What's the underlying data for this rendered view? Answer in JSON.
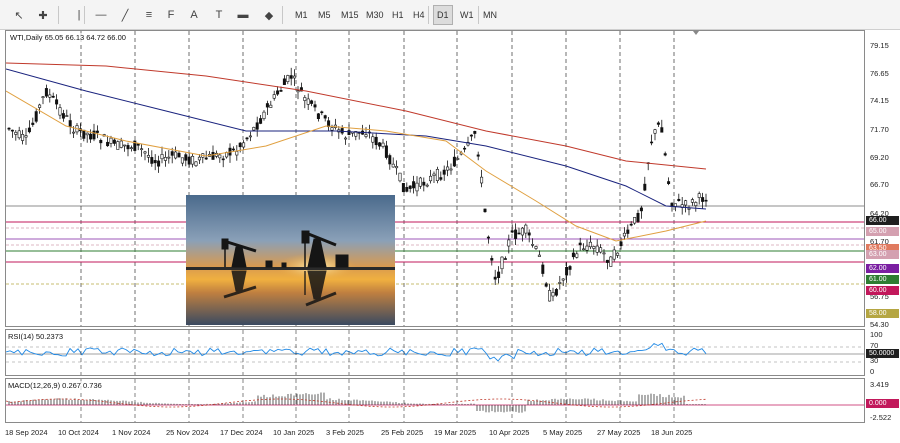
{
  "toolbar": {
    "tools": [
      {
        "name": "cursor-icon",
        "glyph": "↖"
      },
      {
        "name": "crosshair-icon",
        "glyph": "✚"
      },
      {
        "name": "vertical-line-icon",
        "glyph": "|"
      },
      {
        "name": "horizontal-line-icon",
        "glyph": "—"
      },
      {
        "name": "trendline-icon",
        "glyph": "╱"
      },
      {
        "name": "channel-icon",
        "glyph": "≡"
      },
      {
        "name": "fibonacci-icon",
        "glyph": "F"
      },
      {
        "name": "text-icon",
        "glyph": "A"
      },
      {
        "name": "text-label-icon",
        "glyph": "T"
      },
      {
        "name": "rectangle-icon",
        "glyph": "▬"
      },
      {
        "name": "shapes-icon",
        "glyph": "◆"
      }
    ],
    "timeframes": [
      "M1",
      "M5",
      "M15",
      "M30",
      "H1",
      "H4",
      "D1",
      "W1",
      "MN"
    ],
    "active_timeframe": "D1"
  },
  "chart": {
    "symbol_header": "WTI,Daily  65.05 66.13 64.72 66.00",
    "price_ticks": [
      "79.15",
      "76.65",
      "74.15",
      "71.70",
      "69.20",
      "66.70",
      "64.20",
      "61.70",
      "59.25",
      "56.75",
      "54.30"
    ],
    "price_labels": [
      {
        "text": "66.00",
        "bg": "#1f1f1f"
      },
      {
        "text": "65.00",
        "bg": "#d4a0b0"
      },
      {
        "text": "63.50",
        "bg": "#e07a5f"
      },
      {
        "text": "63.00",
        "bg": "#d4a0b0"
      },
      {
        "text": "62.00",
        "bg": "#7b1fa2"
      },
      {
        "text": "61.00",
        "bg": "#2e7d32"
      },
      {
        "text": "60.00",
        "bg": "#c2185b"
      },
      {
        "text": "58.00",
        "bg": "#b5a642"
      }
    ],
    "dates": [
      "18 Sep 2024",
      "10 Oct 2024",
      "1 Nov 2024",
      "25 Nov 2024",
      "17 Dec 2024",
      "10 Jan 2025",
      "3 Feb 2025",
      "25 Feb 2025",
      "19 Mar 2025",
      "10 Apr 2025",
      "5 May 2025",
      "27 May 2025",
      "18 Jun 2025"
    ]
  },
  "rsi": {
    "title": "RSI(14) 50.2373",
    "ticks": [
      "100",
      "70",
      "30",
      "0"
    ],
    "level_label": "50.0000"
  },
  "macd": {
    "title": "MACD(12,26,9) 0.267 0.736",
    "ticks": [
      "3.419",
      "-2.522"
    ],
    "level_label": "0.000"
  },
  "colors": {
    "ma_long": "#c0392b",
    "ma_mid": "#1a237e",
    "ma_short": "#e0a040",
    "rsi_line": "#1e88e5",
    "macd_signal": "#c0392b"
  }
}
